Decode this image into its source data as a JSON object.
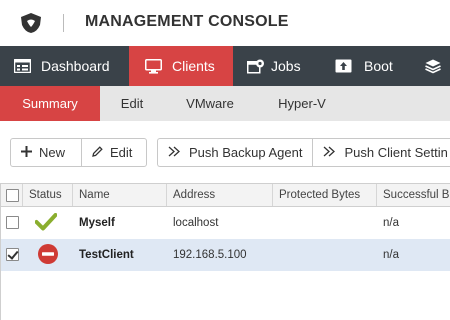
{
  "header": {
    "logo_icon": "shield-logo-icon",
    "title": "MANAGEMENT CONSOLE"
  },
  "main_nav": {
    "items": [
      {
        "label": "Dashboard",
        "icon": "dashboard-icon"
      },
      {
        "label": "Clients",
        "icon": "monitor-icon",
        "active": true
      },
      {
        "label": "Jobs",
        "icon": "jobs-icon"
      },
      {
        "label": "Boot",
        "icon": "boot-icon"
      },
      {
        "label": "",
        "icon": "stack-icon"
      }
    ],
    "active_color": "#d74444",
    "background_color": "#3a4249"
  },
  "sub_nav": {
    "items": [
      {
        "label": "Summary",
        "active": true
      },
      {
        "label": "Edit"
      },
      {
        "label": "VMware"
      },
      {
        "label": "Hyper-V"
      }
    ]
  },
  "toolbar": {
    "new_label": "New",
    "edit_label": "Edit",
    "push_agent_label": "Push Backup Agent",
    "push_settings_label": "Push Client Settin"
  },
  "grid": {
    "columns": [
      "Status",
      "Name",
      "Address",
      "Protected Bytes",
      "Successful Ba"
    ],
    "rows": [
      {
        "checked": false,
        "status": "ok-check-icon",
        "name": "Myself",
        "address": "localhost",
        "protected_bytes": "",
        "successful": "n/a",
        "selected": false
      },
      {
        "checked": true,
        "status": "error-stop-icon",
        "name": "TestClient",
        "address": "192.168.5.100",
        "protected_bytes": "",
        "successful": "n/a",
        "selected": true
      }
    ]
  }
}
